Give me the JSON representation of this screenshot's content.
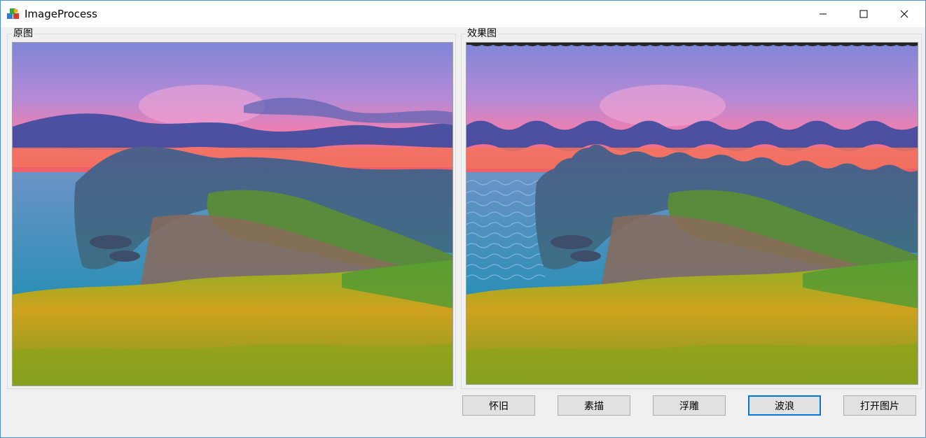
{
  "window": {
    "title": "ImageProcess",
    "icon": "app-cubes-icon",
    "controls": [
      "minimize-icon",
      "maximize-icon",
      "close-icon"
    ]
  },
  "original_group": {
    "label": "原图"
  },
  "effect_group": {
    "label": "效果图"
  },
  "buttons": {
    "nostalgia": "怀旧",
    "sketch": "素描",
    "emboss": "浮雕",
    "wave": "波浪",
    "open_image": "打开图片"
  },
  "colors": {
    "focus_border": "#0078d7",
    "window_border": "#4a8fd8",
    "button_bg": "#e1e1e1"
  }
}
